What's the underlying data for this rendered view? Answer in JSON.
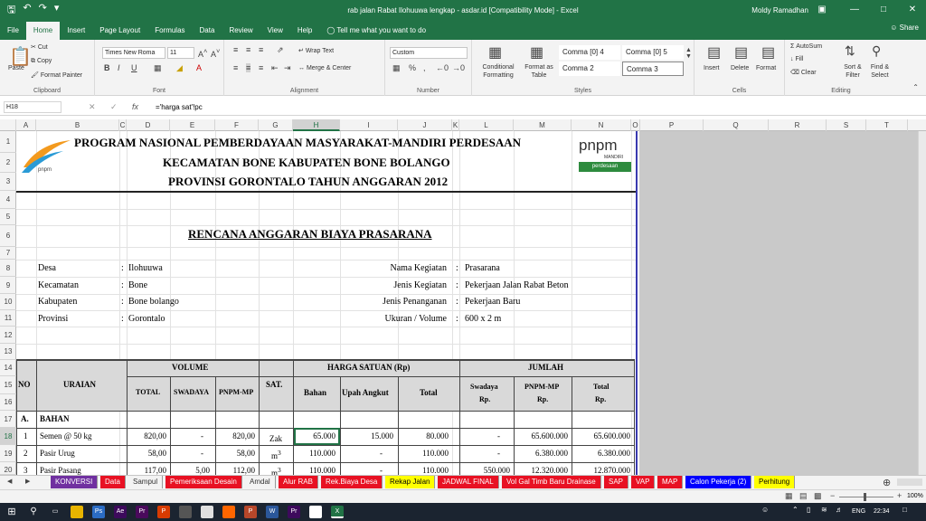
{
  "titlebar": {
    "title": "rab jalan Rabat Ilohuuwa lengkap - asdar.id  [Compatibility Mode]  -  Excel",
    "user": "Moldy Ramadhan"
  },
  "tabs": [
    "File",
    "Home",
    "Insert",
    "Page Layout",
    "Formulas",
    "Data",
    "Review",
    "View",
    "Help"
  ],
  "tell_me": "Tell me what you want to do",
  "share": "Share",
  "ribbon": {
    "clipboard": {
      "paste": "Paste",
      "cut": "Cut",
      "copy": "Copy",
      "format_painter": "Format Painter",
      "label": "Clipboard"
    },
    "font": {
      "name": "Times New Roma",
      "size": "11",
      "label": "Font"
    },
    "alignment": {
      "wrap": "Wrap Text",
      "merge": "Merge & Center",
      "label": "Alignment"
    },
    "number": {
      "format": "Custom",
      "label": "Number"
    },
    "styles": {
      "cond": "Conditional Formatting",
      "table": "Format as Table",
      "cells": [
        "Comma [0] 4",
        "Comma [0] 5",
        "Comma 2",
        "Comma 3"
      ],
      "label": "Styles"
    },
    "cells": {
      "insert": "Insert",
      "delete": "Delete",
      "format": "Format",
      "label": "Cells"
    },
    "editing": {
      "autosum": "AutoSum",
      "fill": "Fill",
      "clear": "Clear",
      "sort": "Sort & Filter",
      "find": "Find & Select",
      "label": "Editing"
    }
  },
  "formula_bar": {
    "namebox": "H18",
    "formula": "='harga sat'!pc"
  },
  "columns": [
    "A",
    "B",
    "C",
    "D",
    "E",
    "F",
    "G",
    "H",
    "I",
    "J",
    "K",
    "L",
    "M",
    "N",
    "O",
    "P",
    "Q",
    "R",
    "S",
    "T"
  ],
  "rows": [
    "1",
    "2",
    "3",
    "4",
    "5",
    "6",
    "7",
    "8",
    "9",
    "10",
    "11",
    "12",
    "13",
    "14",
    "15",
    "16",
    "17",
    "18",
    "19",
    "20"
  ],
  "sheet": {
    "header1": "PROGRAM NASIONAL PEMBERDAYAAN MASYARAKAT-MANDIRI PERDESAAN",
    "header2": "KECAMATAN BONE KABUPATEN BONE BOLANGO",
    "header3": "PROVINSI GORONTALO TAHUN ANGGARAN 2012",
    "logo_left": "pnpm",
    "logo_right_main": "pnpm",
    "logo_right_sub": "MANDIRI",
    "logo_right_tag": "perdesaan",
    "doc_title": "RENCANA ANGGARAN BIAYA PRASARANA",
    "info_left": [
      {
        "label": "Desa",
        "value": "Ilohuuwa"
      },
      {
        "label": "Kecamatan",
        "value": "Bone"
      },
      {
        "label": "Kabupaten",
        "value": "Bone bolango"
      },
      {
        "label": "Provinsi",
        "value": "Gorontalo"
      }
    ],
    "info_right": [
      {
        "label": "Nama Kegiatan",
        "value": "Prasarana"
      },
      {
        "label": "Jenis Kegiatan",
        "value": "Pekerjaan Jalan Rabat Beton"
      },
      {
        "label": "Jenis Penanganan",
        "value": "Pekerjaan Baru"
      },
      {
        "label": "Ukuran / Volume",
        "value": "600 x 2 m"
      }
    ],
    "table_headers": {
      "no": "NO",
      "uraian": "URAIAN",
      "volume": "VOLUME",
      "total": "TOTAL",
      "swadaya": "SWADAYA",
      "pnpm_mp": "PNPM-MP",
      "sat": "SAT.",
      "harga": "HARGA  SATUAN (Rp)",
      "bahan": "Bahan",
      "upah": "Upah Angkut",
      "htotal": "Total",
      "jumlah": "JUMLAH",
      "j_swadaya": "Swadaya",
      "j_pnpm": "PNPM-MP",
      "j_total": "Total",
      "rp": "Rp."
    },
    "section_a": {
      "no": "A.",
      "name": "BAHAN"
    },
    "items": [
      {
        "no": "1",
        "uraian": "Semen @ 50 kg",
        "total": "820,00",
        "swadaya": "-",
        "pnpm": "820,00",
        "sat": "Zak",
        "sat_sup": "",
        "bahan": "65.000",
        "upah": "15.000",
        "htotal": "80.000",
        "j_swadaya": "-",
        "j_pnpm": "65.600.000",
        "j_total": "65.600.000"
      },
      {
        "no": "2",
        "uraian": "Pasir Urug",
        "total": "58,00",
        "swadaya": "-",
        "pnpm": "58,00",
        "sat": "m",
        "sat_sup": "3",
        "bahan": "110.000",
        "upah": "-",
        "htotal": "110.000",
        "j_swadaya": "-",
        "j_pnpm": "6.380.000",
        "j_total": "6.380.000"
      },
      {
        "no": "3",
        "uraian": "Pasir Pasang",
        "total": "117,00",
        "swadaya": "5,00",
        "pnpm": "112,00",
        "sat": "m",
        "sat_sup": "3",
        "bahan": "110.000",
        "upah": "-",
        "htotal": "110.000",
        "j_swadaya": "550.000",
        "j_pnpm": "12.320.000",
        "j_total": "12.870.000"
      }
    ]
  },
  "sheet_tabs": [
    {
      "label": "KONVERSI",
      "bg": "#7030a0",
      "fg": "#ffffff"
    },
    {
      "label": "Data",
      "bg": "#e81123",
      "fg": "#ffffff"
    },
    {
      "label": "Sampul",
      "bg": "#f3f3f3",
      "fg": "#333333"
    },
    {
      "label": "Pemeriksaan Desain",
      "bg": "#e81123",
      "fg": "#ffffff"
    },
    {
      "label": "Amdal",
      "bg": "#f3f3f3",
      "fg": "#333333"
    },
    {
      "label": "Alur RAB",
      "bg": "#e81123",
      "fg": "#ffffff"
    },
    {
      "label": "Rek.Biaya Desa",
      "bg": "#e81123",
      "fg": "#ffffff"
    },
    {
      "label": "Rekap Jalan",
      "bg": "#ffff00",
      "fg": "#000000"
    },
    {
      "label": "JADWAL FINAL",
      "bg": "#e81123",
      "fg": "#ffffff"
    },
    {
      "label": "Vol Gal Timb Baru Drainase",
      "bg": "#e81123",
      "fg": "#ffffff"
    },
    {
      "label": "SAP",
      "bg": "#e81123",
      "fg": "#ffffff"
    },
    {
      "label": "VAP",
      "bg": "#e81123",
      "fg": "#ffffff"
    },
    {
      "label": "MAP",
      "bg": "#e81123",
      "fg": "#ffffff"
    },
    {
      "label": "Calon Pekerja (2)",
      "bg": "#0000ff",
      "fg": "#ffffff"
    },
    {
      "label": "Perhitung",
      "bg": "#ffff00",
      "fg": "#000000"
    }
  ],
  "status": {
    "zoom": "100%"
  },
  "taskbar": {
    "lang": "ENG",
    "time": "22:34"
  }
}
